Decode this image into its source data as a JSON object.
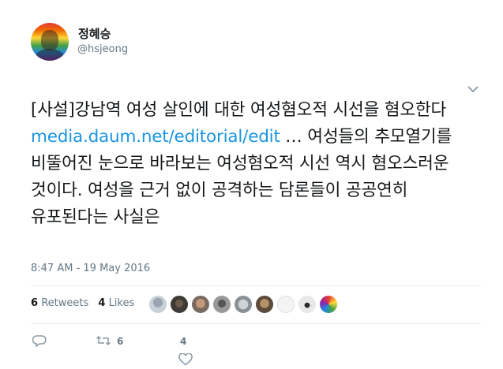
{
  "user": {
    "display_name": "정혜승",
    "handle": "@hsjeong"
  },
  "tweet": {
    "text_before_link": "[사설]강남역 여성 살인에 대한 여성혐오적 시선을 혐오한다 ",
    "link": "media.daum.net/editorial/edit",
    "text_after_link": " … 여성들의 추모열기를 비뚤어진 눈으로 바라보는 여성혐오적 시선 역시 혐오스러운 것이다. 여성을 근거 없이 공격하는 담론들이 공공연히 유포된다는 사실은",
    "timestamp": "8:47 AM - 19 May 2016"
  },
  "stats": {
    "retweets_count": "6",
    "retweets_label": "Retweets",
    "likes_count": "4",
    "likes_label": "Likes"
  },
  "actions": {
    "reply_icon": "reply-icon",
    "retweet_icon": "retweet-icon",
    "retweet_count": "6",
    "like_icon": "heart-icon",
    "like_count": "4",
    "dm_icon": "envelope-icon"
  },
  "colors": {
    "link": "#1b95e0",
    "muted": "#657786",
    "text": "#14171a"
  }
}
